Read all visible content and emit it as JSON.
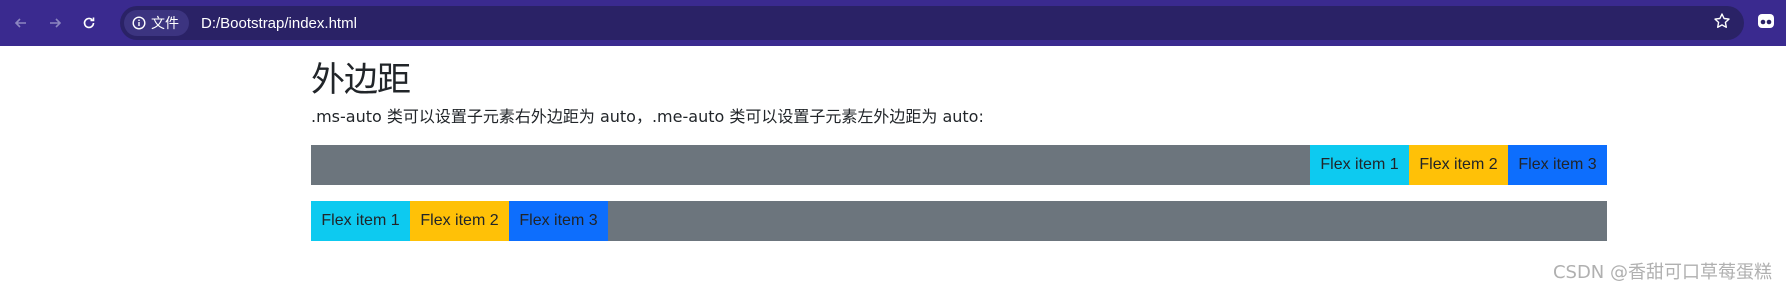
{
  "browser": {
    "back_icon": "arrow-left-icon",
    "forward_icon": "arrow-right-icon",
    "reload_icon": "reload-icon",
    "site_chip_label": "文件",
    "url": "D:/Bootstrap/index.html",
    "star_icon": "star-icon",
    "profile_icon": "profile-icon",
    "bar_color": "#3a2a8f",
    "omnibox_color": "#2a2266"
  },
  "page": {
    "title": "外边距",
    "description": ".ms-auto 类可以设置子元素右外边距为 auto，.me-auto 类可以设置子元素左外边距为 auto:",
    "row1": {
      "items": [
        "Flex item 1",
        "Flex item 2",
        "Flex item 3"
      ]
    },
    "row2": {
      "items": [
        "Flex item 1",
        "Flex item 2",
        "Flex item 3"
      ]
    },
    "colors": {
      "container": "#6c757d",
      "info": "#0dcaf0",
      "warning": "#ffc107",
      "primary": "#0d6efd"
    }
  },
  "watermark": "CSDN @香甜可口草莓蛋糕"
}
